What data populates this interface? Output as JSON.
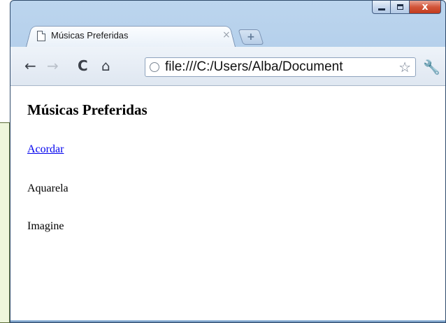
{
  "browser": {
    "tab_title": "Músicas Preferidas",
    "tab_close": "×",
    "new_tab": "+",
    "url": "file:///C:/Users/Alba/Documents/musicas.html",
    "url_visible": "file:///C:/Users/Alba/Document",
    "icons": {
      "back": "←",
      "forward": "→",
      "reload": "C",
      "home": "⌂",
      "star": "☆",
      "wrench": "🔧",
      "close": "x"
    }
  },
  "page": {
    "heading": "Músicas Preferidas",
    "songs": [
      {
        "title": "Acordar",
        "link": true
      },
      {
        "title": "Aquarela",
        "link": false
      },
      {
        "title": "Imagine",
        "link": false
      }
    ]
  },
  "colors": {
    "link": "#0000ee",
    "frame": "#a9c7e6",
    "close_button": "#c23a1d"
  }
}
